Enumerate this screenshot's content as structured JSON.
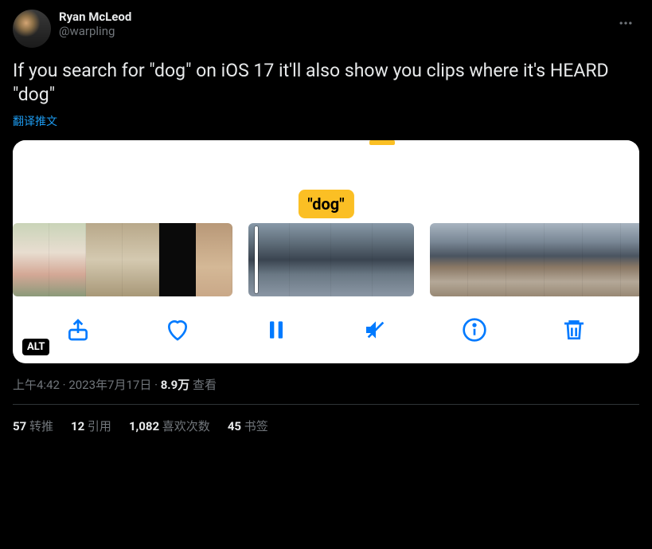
{
  "author": {
    "name": "Ryan McLeod",
    "handle": "@warpling"
  },
  "body": "If you search for \"dog\" on iOS 17 it'll also show you clips where it's HEARD \"dog\"",
  "translate": "翻译推文",
  "media": {
    "search_label": "\"dog\"",
    "alt_badge": "ALT"
  },
  "meta": {
    "time": "上午4:42",
    "date": "2023年7月17日",
    "views_count": "8.9万",
    "views_label": "查看"
  },
  "stats": {
    "retweets": {
      "count": "57",
      "label": "转推"
    },
    "quotes": {
      "count": "12",
      "label": "引用"
    },
    "likes": {
      "count": "1,082",
      "label": "喜欢次数"
    },
    "bookmarks": {
      "count": "45",
      "label": "书签"
    }
  }
}
